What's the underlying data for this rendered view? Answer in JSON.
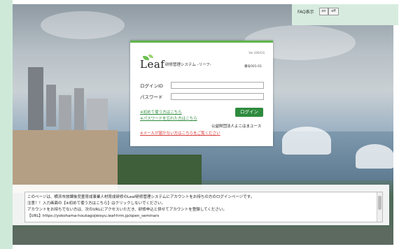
{
  "faq": {
    "label": "FAQ表示",
    "on": "on",
    "off": "off"
  },
  "login": {
    "version": "Ver.19041S",
    "logo_text": "Leaf",
    "subtitle": "研修管理システム -リーフ-",
    "tenant": "番号001-01",
    "login_id_label": "ログインID",
    "password_label": "パスワード",
    "link_first_time": "※初めて使う方はこちら",
    "link_forgot_password": "※パスワードを忘れた方はこちら",
    "login_button": "ログイン",
    "organization": "公益財団法人よこはまユース",
    "link_no_email": "※メールが届かない方はこちらをご覧ください"
  },
  "notice": {
    "line1": "このページは、横浜市放課後児童育成事業人材育成研修のLeaf研修管理システムにアカウントをお持ちの方のログインページです。",
    "line2": "注意！！入力画面の【※初めて使う方はこちら】はクリックしないでください。",
    "line3": "アカウントをお持ちでない方は、次のURLにアクセスいただき、研修申込と併せてアカウントを登録してください。",
    "line4": "【URL】https://yokohama-houkagojieisyu.leaf-hrm.jp/open_seminars"
  },
  "colors": {
    "accent": "#2e8b3e",
    "warning": "#d83a3a",
    "panel": "#d7ecdf"
  }
}
